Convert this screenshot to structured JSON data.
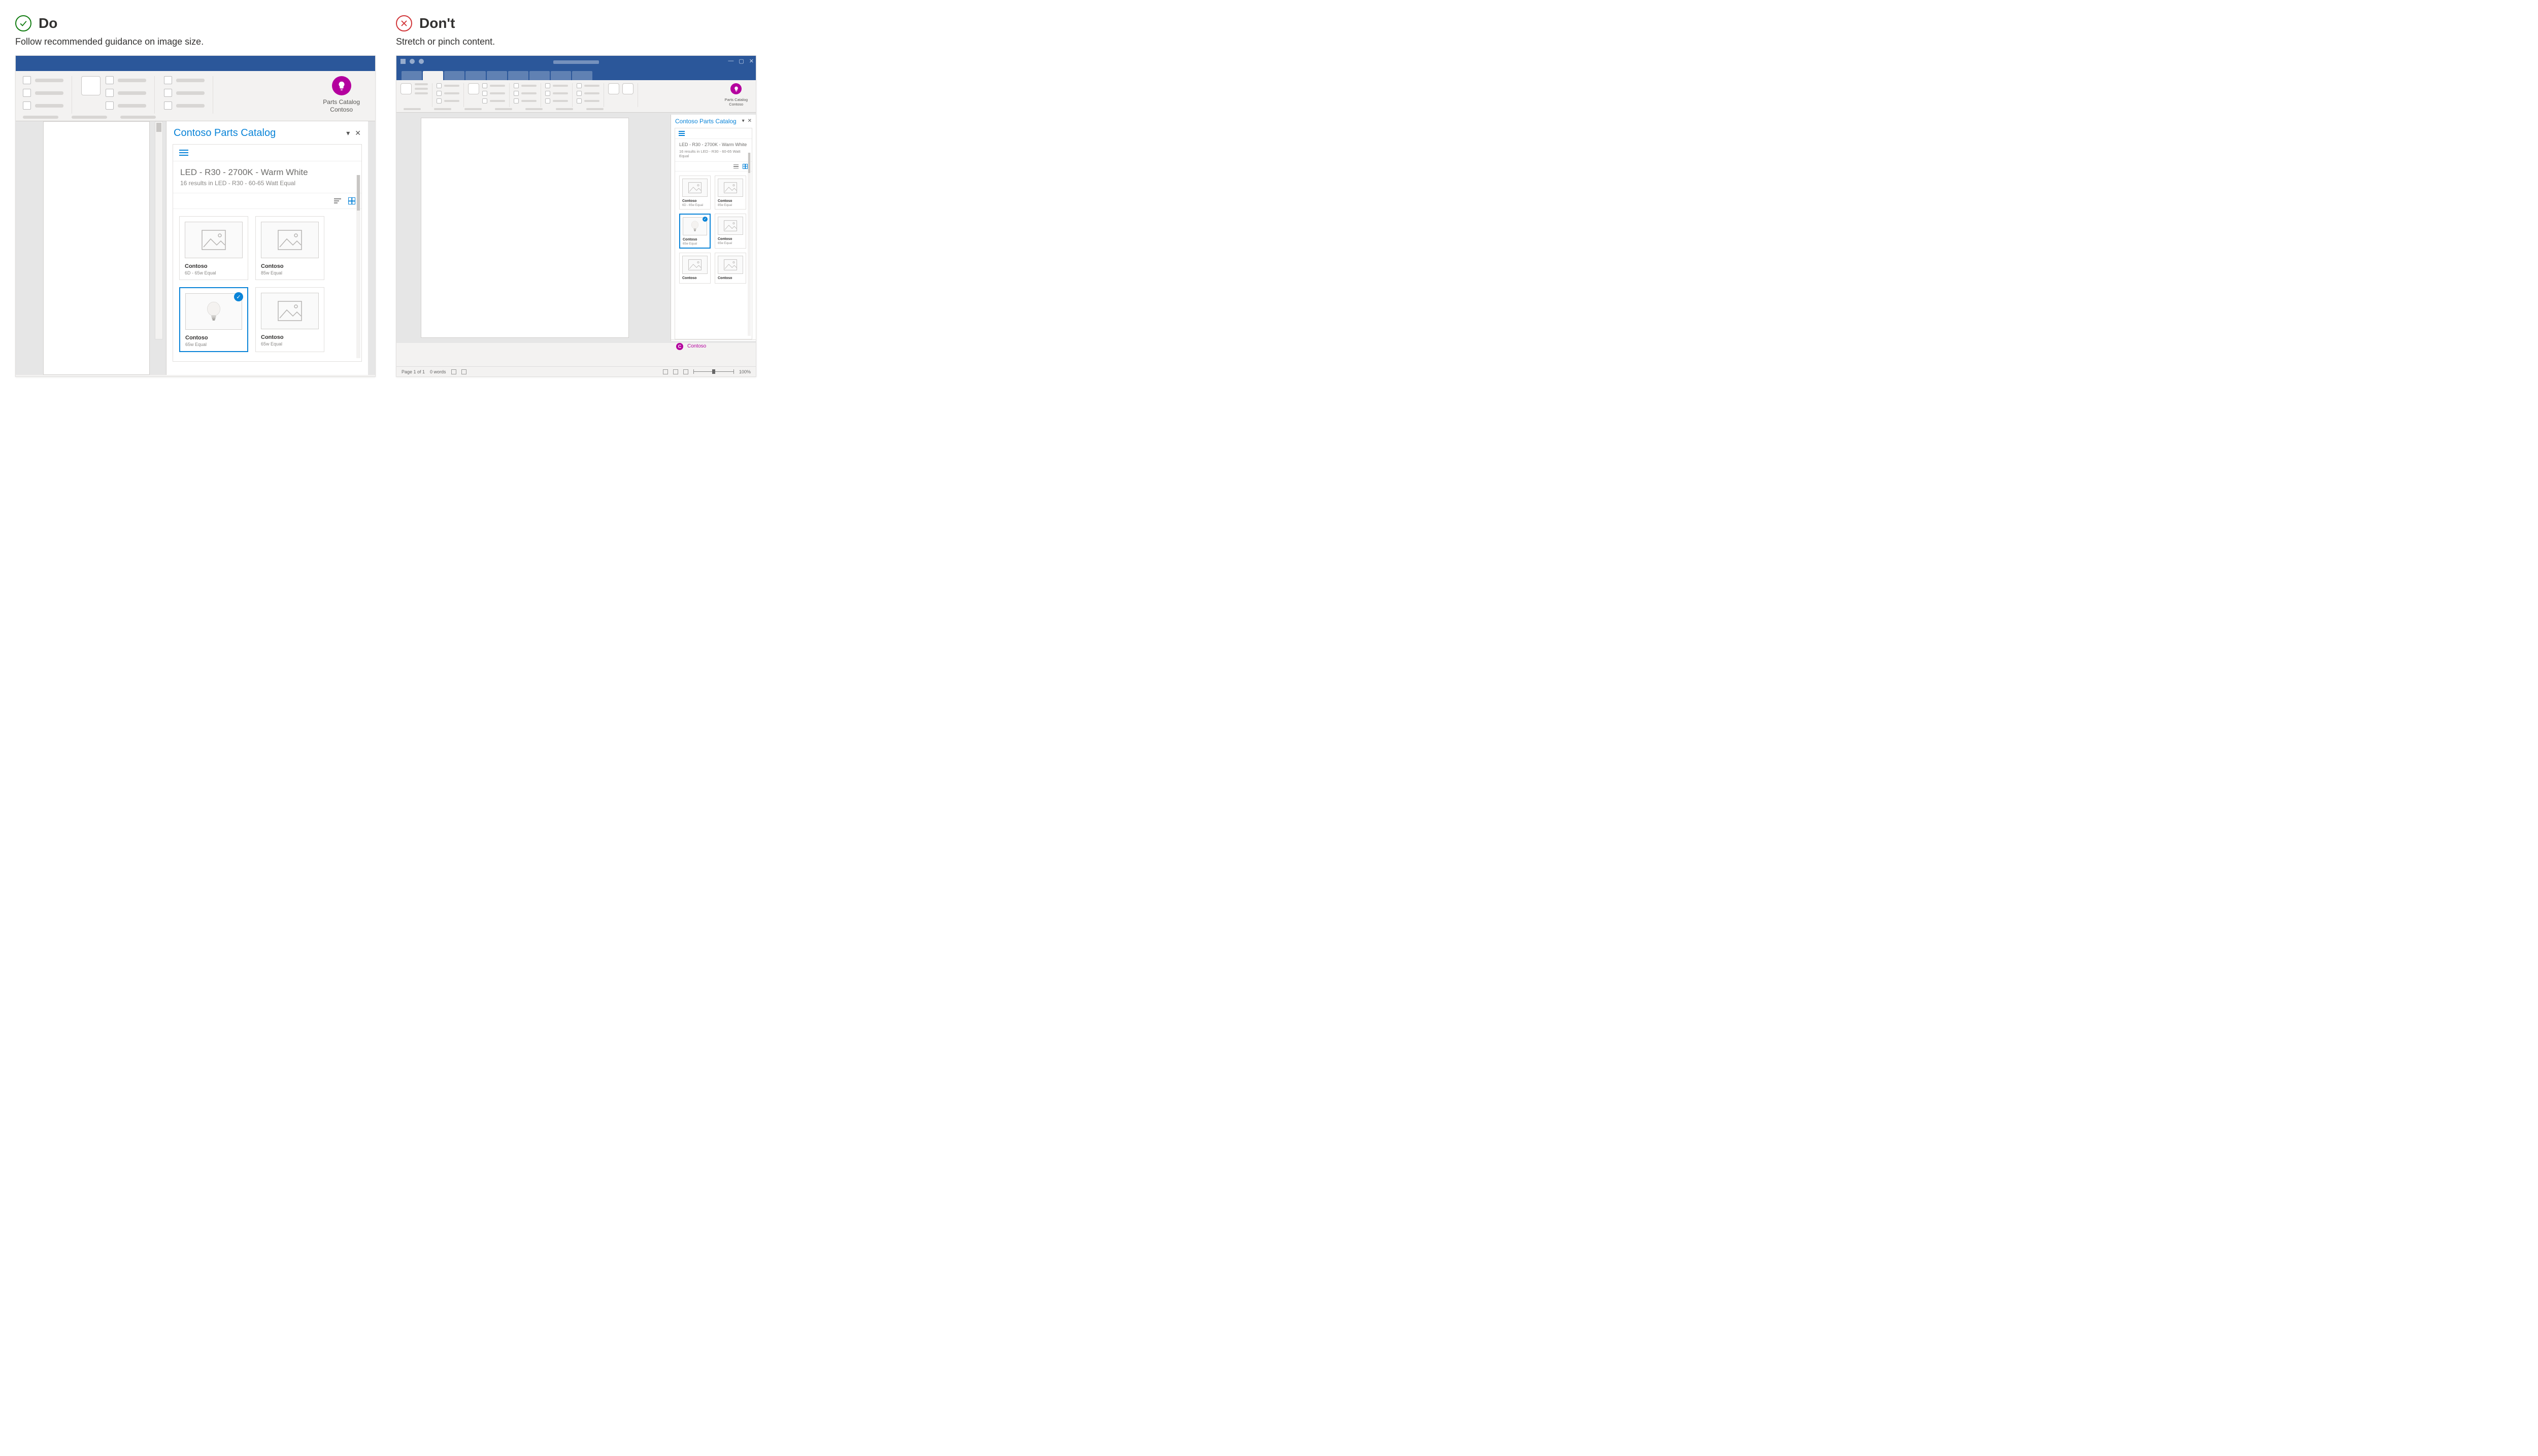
{
  "do": {
    "heading": "Do",
    "subtitle": "Follow recommended guidance on image size."
  },
  "dont": {
    "heading": "Don't",
    "subtitle": "Stretch or pinch content."
  },
  "addin": {
    "line1": "Parts Catalog",
    "line2": "Contoso"
  },
  "pane": {
    "title": "Contoso Parts Catalog",
    "search_title": "LED - R30 - 2700K - Warm White",
    "search_subtitle": "16 results in LED - R30 - 60-65 Watt Equal",
    "footer_brand": "Contoso",
    "footer_letter": "C"
  },
  "tiles": [
    {
      "brand": "Contoso",
      "meta": "6D - 65w Equal",
      "selected": false,
      "image": "placeholder"
    },
    {
      "brand": "Contoso",
      "meta": "85w Equal",
      "selected": false,
      "image": "placeholder"
    },
    {
      "brand": "Contoso",
      "meta": "65w Equal",
      "selected": true,
      "image": "bulb"
    },
    {
      "brand": "Contoso",
      "meta": "65w Equal",
      "selected": false,
      "image": "placeholder"
    },
    {
      "brand": "Contoso",
      "meta": "",
      "selected": false,
      "image": "placeholder"
    },
    {
      "brand": "Contoso",
      "meta": "",
      "selected": false,
      "image": "placeholder"
    }
  ],
  "status": {
    "page": "Page 1 of 1",
    "words": "0 words",
    "zoom": "100%"
  }
}
